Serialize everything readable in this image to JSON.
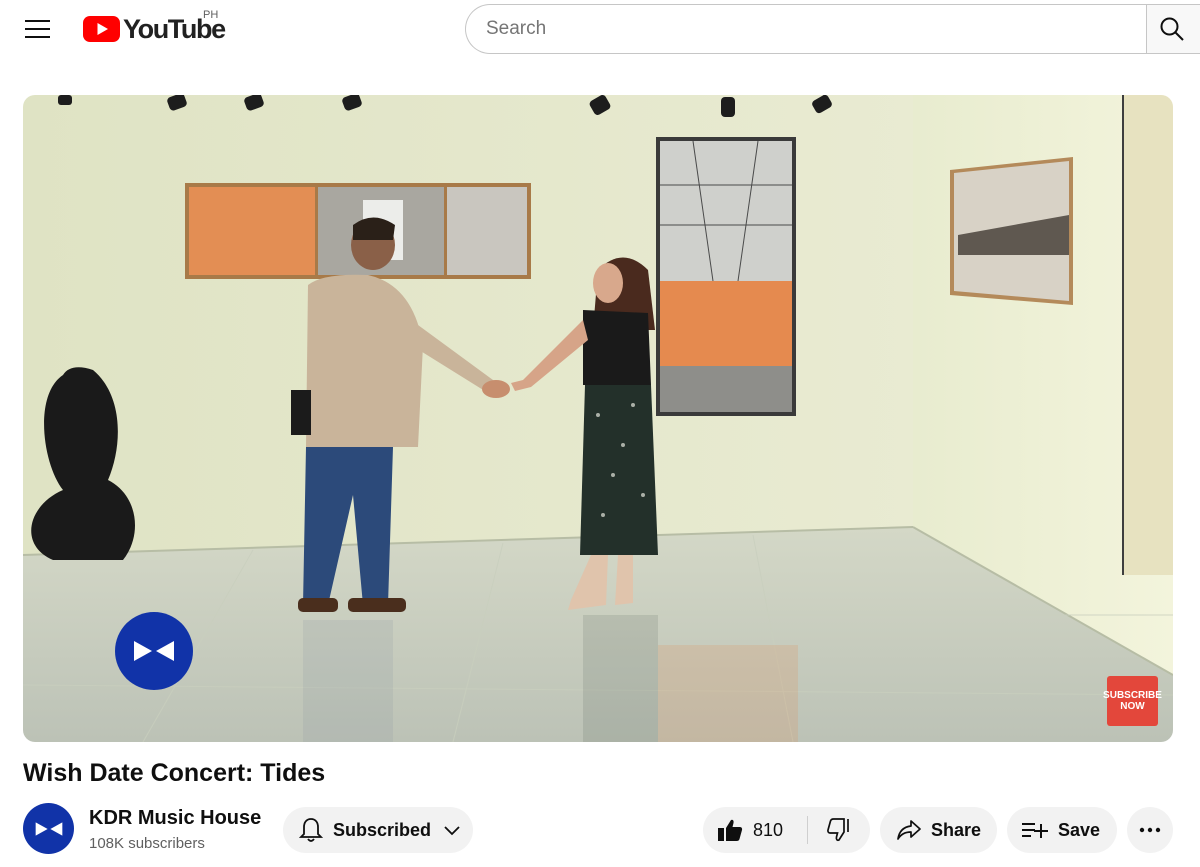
{
  "header": {
    "menu_icon": "hamburger-menu-icon",
    "logo_text": "YouTube",
    "country_code": "PH",
    "search_placeholder": "Search",
    "search_icon": "search-icon",
    "brand_color": "#ff0000"
  },
  "player": {
    "watermark_icon": "channel-logo-icon",
    "subscribe_badge_line1": "SUBSCRIBE",
    "subscribe_badge_line2": "NOW",
    "badge_color": "#e3473b"
  },
  "video": {
    "title": "Wish Date Concert: Tides"
  },
  "channel": {
    "name": "KDR Music House",
    "subscribers": "108K subscribers",
    "avatar_color": "#1133a8"
  },
  "actions": {
    "subscribed_label": "Subscribed",
    "like_count": "810",
    "share_label": "Share",
    "save_label": "Save",
    "icons": [
      "bell-icon",
      "chevron-down-icon",
      "thumbs-up-icon",
      "thumbs-down-icon",
      "share-arrow-icon",
      "playlist-add-icon",
      "more-horizontal-icon"
    ]
  }
}
